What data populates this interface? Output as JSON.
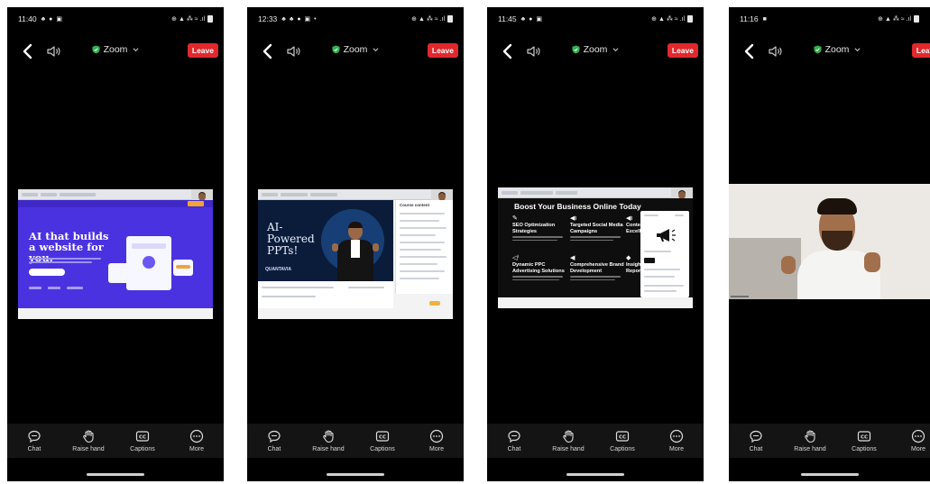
{
  "colors": {
    "leave": "#e0282d",
    "shield": "#2fb24a",
    "bar": "#141414"
  },
  "phones": [
    {
      "status": {
        "time": "11:40",
        "icons": "♣ ● ▣",
        "right": "⊕ ▲ ⁂ ≈ .ıl"
      },
      "zoom_label": "Zoom",
      "leave_label": "Leave",
      "slide": {
        "headline": "AI that builds a website for you."
      }
    },
    {
      "status": {
        "time": "12:33",
        "icons": "♣ ♣ ● ▣ •",
        "right": "⊕ ▲ ⁂ ≈ .ıl"
      },
      "zoom_label": "Zoom",
      "leave_label": "Leave",
      "slide": {
        "title": "AI-Powered PPTs!",
        "badge": "QUANTAVIA",
        "sidebar_title": "Course content"
      }
    },
    {
      "status": {
        "time": "11:45",
        "icons": "♣ ● ▣",
        "right": "⊕ ▲ ⁂ ≈ .ıl"
      },
      "zoom_label": "Zoom",
      "leave_label": "Leave",
      "slide": {
        "title": "Boost Your Business Online Today",
        "items": [
          {
            "icon": "✎",
            "title": "SEO Optimization Strategies"
          },
          {
            "icon": "◀ı",
            "title": "Targeted Social Media Campaigns"
          },
          {
            "icon": "◀ı",
            "title": "Conten Excell"
          },
          {
            "icon": "◁⁾",
            "title": "Dynamic PPC Advertising Solutions"
          },
          {
            "icon": "◀",
            "title": "Comprehensive Brand Development"
          },
          {
            "icon": "◆",
            "title": "Insight Report"
          }
        ]
      }
    },
    {
      "status": {
        "time": "11:16",
        "icons": "■",
        "right": "⊕ ▲ ⁂ ≈ .ıl"
      },
      "zoom_label": "Zoom",
      "leave_label": "Leave"
    }
  ],
  "bottom_bar": {
    "chat": "Chat",
    "raise_hand": "Raise hand",
    "captions": "Captions",
    "more": "More",
    "cc_text": "CC"
  }
}
